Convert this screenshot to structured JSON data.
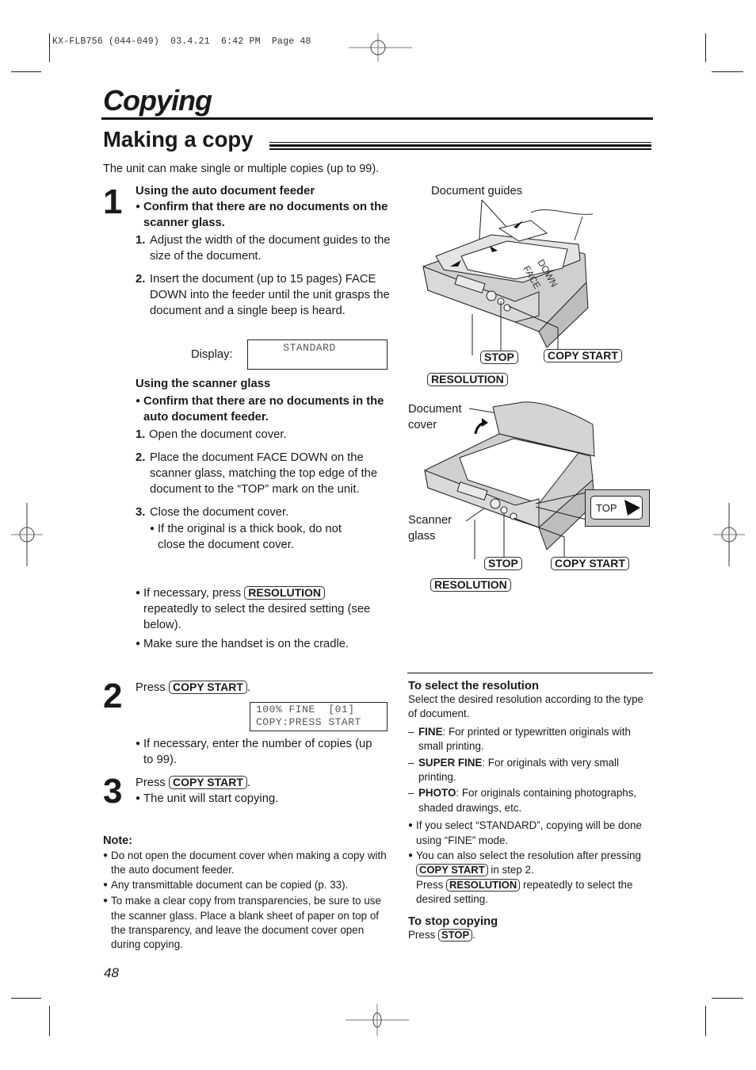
{
  "print_header": "KX-FLB756 (044-049)  03.4.21  6:42 PM  Page 48",
  "chapter_title": "Copying",
  "section_title": "Making a copy",
  "intro": "The unit can make single or multiple copies (up to 99).",
  "step1": {
    "number": "1",
    "adf": {
      "heading": "Using the auto document feeder",
      "confirm": "Confirm that there are no documents on the scanner glass.",
      "items": [
        {
          "num": "1.",
          "text": "Adjust the width of the document guides to the size of the document."
        },
        {
          "num": "2.",
          "text": "Insert the document (up to 15 pages) FACE DOWN into the feeder until the unit grasps the document and a single beep is heard."
        }
      ],
      "display_label": "Display:",
      "display_value": "STANDARD"
    },
    "glass": {
      "heading": "Using the scanner glass",
      "confirm": "Confirm that there are no documents in the auto document feeder.",
      "items": [
        {
          "num": "1.",
          "text": "Open the document cover."
        },
        {
          "num": "2.",
          "text": "Place the document FACE DOWN on the scanner glass, matching the top edge of the document to the “TOP” mark on the unit."
        },
        {
          "num": "3.",
          "text": "Close the document cover."
        }
      ],
      "sub_bullet": "If the original is a thick book, do not close the document cover."
    },
    "bullet_resolution_pre": "If necessary, press",
    "bullet_resolution_key": "RESOLUTION",
    "bullet_resolution_post": "repeatedly to select the desired setting (see below).",
    "bullet_handset": "Make sure the handset is on the cradle."
  },
  "step2": {
    "number": "2",
    "press": "Press",
    "key": "COPY START",
    "period": ".",
    "display_line1": "100% FINE  [01]",
    "display_line2": "COPY:PRESS START",
    "bullet": "If necessary, enter the number of copies (up to 99)."
  },
  "step3": {
    "number": "3",
    "press": "Press",
    "key": "COPY START",
    "period": ".",
    "bullet": "The unit will start copying."
  },
  "note": {
    "heading": "Note:",
    "items": [
      "Do not open the document cover when making a copy with the auto document feeder.",
      "Any transmittable document can be copied (p. 33).",
      "To make a clear copy from transparencies, be sure to use the scanner glass. Place a blank sheet of paper on top of the transparency, and leave the document cover open during copying."
    ]
  },
  "figure1": {
    "label_guides": "Document guides",
    "face_down": "FACE DOWN",
    "keys": {
      "stop": "STOP",
      "copy_start": "COPY START",
      "resolution": "RESOLUTION"
    }
  },
  "figure2": {
    "label_cover": "Document cover",
    "label_glass": "Scanner glass",
    "top_mark": "TOP",
    "keys": {
      "stop": "STOP",
      "copy_start": "COPY START",
      "resolution": "RESOLUTION"
    }
  },
  "resolution": {
    "heading": "To select the resolution",
    "intro": "Select the desired resolution according to the type of document.",
    "options": [
      {
        "name": "FINE",
        "desc": ": For printed or typewritten originals with small printing."
      },
      {
        "name": "SUPER FINE",
        "desc": ": For originals with very small printing."
      },
      {
        "name": "PHOTO",
        "desc": ": For originals containing photographs, shaded drawings, etc."
      }
    ],
    "bullet1": "If you select “STANDARD”, copying will be done using “FINE” mode.",
    "bullet2_pre": "You can also select the resolution after pressing",
    "bullet2_key1": "COPY START",
    "bullet2_mid": "in step 2.",
    "bullet2_press": "Press",
    "bullet2_key2": "RESOLUTION",
    "bullet2_post": "repeatedly to select the desired setting."
  },
  "stop": {
    "heading": "To stop copying",
    "press": "Press",
    "key": "STOP",
    "period": "."
  },
  "page_number": "48"
}
